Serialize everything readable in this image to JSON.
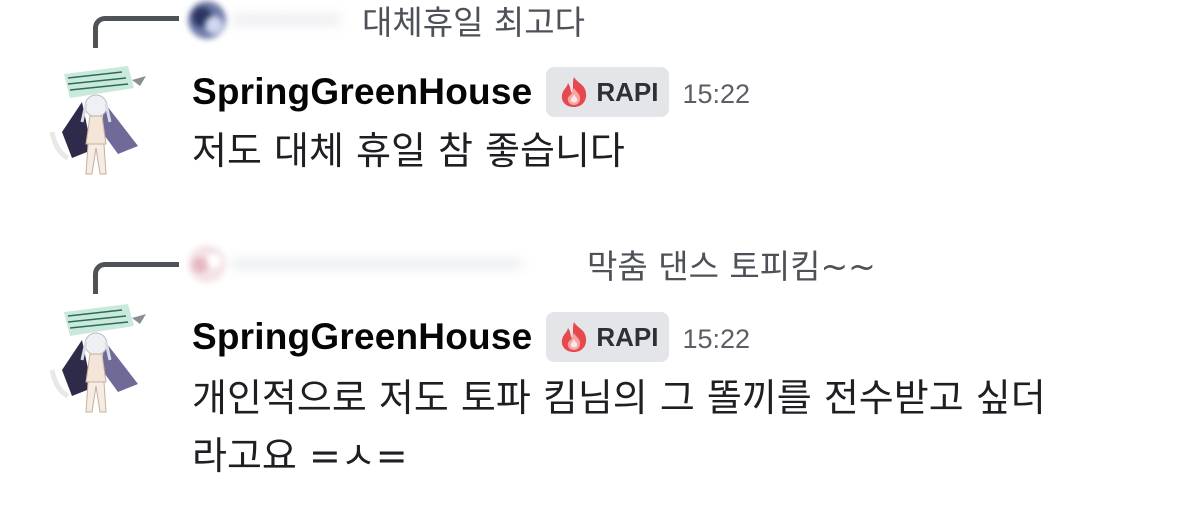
{
  "messages": [
    {
      "reply": {
        "text": "대체휴일 최고다"
      },
      "author": {
        "name": "SpringGreenHouse",
        "role": "RAPI",
        "time": "15:22"
      },
      "content": "저도 대체 휴일 참 좋습니다"
    },
    {
      "reply": {
        "text": "막춤 댄스 토피킴~~"
      },
      "author": {
        "name": "SpringGreenHouse",
        "role": "RAPI",
        "time": "15:22"
      },
      "content_lines": [
        "개인적으로 저도 토파 킴님의 그 똘끼를 전수받고 싶더",
        "라고요 =ㅅ="
      ]
    }
  ],
  "colors": {
    "username": "#060607",
    "role_tag_bg": "#e3e5e8",
    "role_icon": "#e5484d",
    "reply_spine": "#4f5358",
    "reply_text": "#4e5158",
    "timestamp": "#5c5e66",
    "body_text": "#1e1f22"
  },
  "icons": {
    "role": "fire-role-icon",
    "avatar": "anime-character-avatar"
  }
}
